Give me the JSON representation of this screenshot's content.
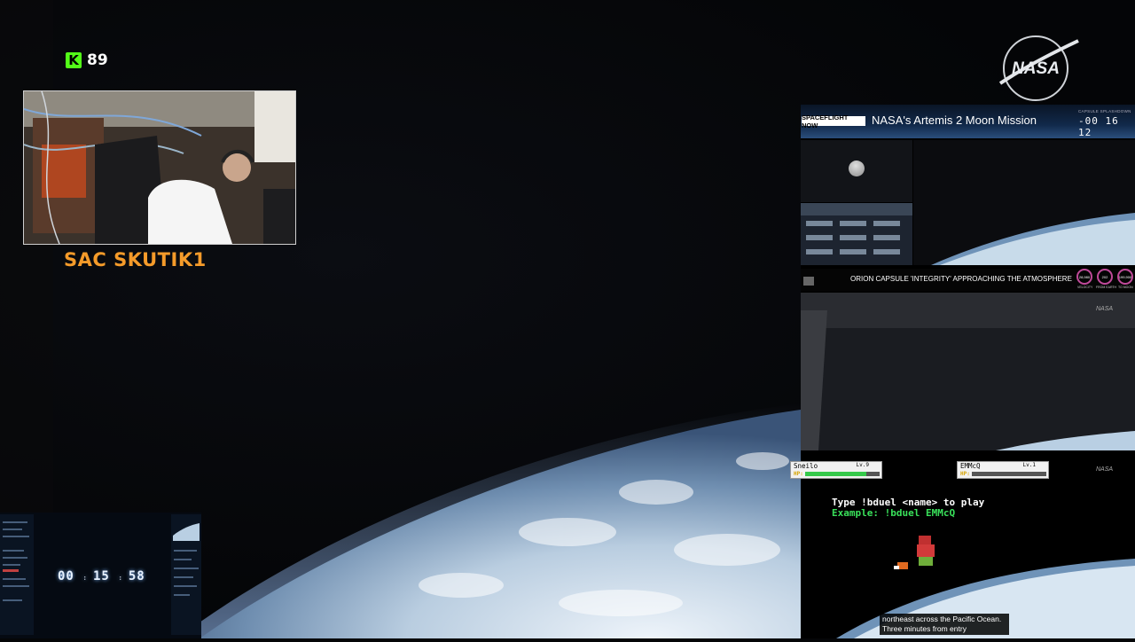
{
  "kick": {
    "icon": "kick-logo-icon",
    "icon_glyph": "K",
    "viewer_count": "89",
    "brand_color": "#53fc18"
  },
  "streamer": {
    "name": "SAC SKUTIK1",
    "name_color": "#f59b2a"
  },
  "nasa_logo": {
    "icon": "nasa-logo-icon",
    "text": "NASA"
  },
  "right_panel": {
    "tag": "SPACEFLIGHT NOW",
    "title": "NASA's Artemis 2 Moon Mission",
    "mission_clock_label": "CAPSULE SPLASHDOWN",
    "mission_clock": "-00 16 12",
    "banner_text": "ORION CAPSULE 'INTEGRITY' APPROACHING THE ATMOSPHERE",
    "gauges": [
      {
        "value": "28,980",
        "label": "VELOCITY"
      },
      {
        "value": "202",
        "label": "FROM EARTH"
      },
      {
        "value": "199,900",
        "label": "TO MOON"
      }
    ],
    "watermark": "NASA"
  },
  "game": {
    "player1": {
      "name": "Sneilo",
      "level": "Lv.9",
      "hp_label": "HP:",
      "hp_fraction": 0.82
    },
    "player2": {
      "name": "EMMcQ",
      "level": "Lv.1",
      "hp_label": "HP:",
      "hp_fraction": 0.0
    },
    "line1": "Type !bduel <name> to play",
    "line2": "Example: !bduel EMMcQ",
    "watermark": "NASA"
  },
  "caption": "northeast across the Pacific Ocean. Three minutes from entry",
  "mini_overlay": {
    "timer": "00:15:58",
    "timer_h": "00",
    "timer_m": "15",
    "timer_s": "58"
  }
}
